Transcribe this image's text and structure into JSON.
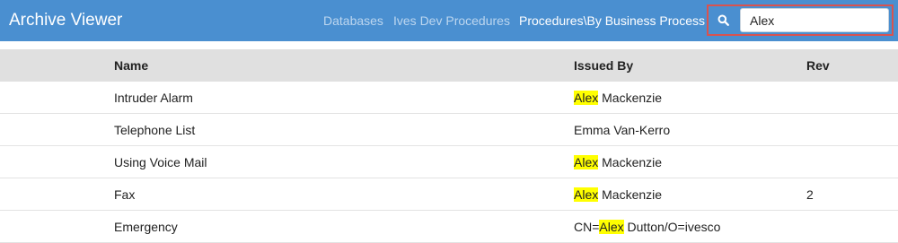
{
  "app": {
    "title": "Archive Viewer"
  },
  "breadcrumbs": [
    {
      "label": "Databases",
      "active": false
    },
    {
      "label": "Ives Dev Procedures",
      "active": false
    },
    {
      "label": "Procedures\\By Business Process",
      "active": true
    }
  ],
  "search": {
    "value": "Alex",
    "placeholder": ""
  },
  "table": {
    "columns": {
      "name": "Name",
      "issued_by": "Issued By",
      "rev": "Rev"
    },
    "rows": [
      {
        "name": "Intruder Alarm",
        "issued_pre": "",
        "issued_hl": "Alex",
        "issued_post": " Mackenzie",
        "rev": ""
      },
      {
        "name": "Telephone List",
        "issued_pre": "Emma Van-Kerro",
        "issued_hl": "",
        "issued_post": "",
        "rev": ""
      },
      {
        "name": "Using Voice Mail",
        "issued_pre": "",
        "issued_hl": "Alex",
        "issued_post": " Mackenzie",
        "rev": ""
      },
      {
        "name": "Fax",
        "issued_pre": "",
        "issued_hl": "Alex",
        "issued_post": " Mackenzie",
        "rev": "2"
      },
      {
        "name": "Emergency",
        "issued_pre": "CN=",
        "issued_hl": "Alex",
        "issued_post": " Dutton/O=ivesco",
        "rev": ""
      }
    ]
  },
  "colors": {
    "navbar": "#4a8fd0",
    "header_row": "#e0e0e0",
    "highlight": "#ffff00",
    "search_border": "#d9534f"
  }
}
